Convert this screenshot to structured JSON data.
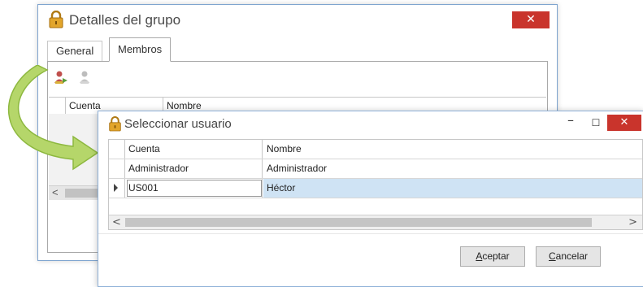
{
  "back_window": {
    "title": "Detalles del grupo",
    "close_glyph": "✕",
    "tabs": [
      {
        "label": "General"
      },
      {
        "label": "Membros"
      }
    ],
    "toolbar_icons": [
      "add-user-icon",
      "remove-user-icon"
    ],
    "grid_columns": [
      "Cuenta",
      "Nombre"
    ],
    "scroll_left_glyph": "<"
  },
  "front_window": {
    "title": "Seleccionar usuario",
    "minimize_glyph": "–",
    "maximize_glyph": "☐",
    "close_glyph": "✕",
    "columns": [
      "Cuenta",
      "Nombre"
    ],
    "rows": [
      {
        "cuenta": "Administrador",
        "nombre": "Administrador",
        "selected": false
      },
      {
        "cuenta": "US001",
        "nombre": "Héctor",
        "selected": true
      }
    ],
    "scroll_left_glyph": "<",
    "scroll_right_glyph": ">",
    "buttons": {
      "accept": {
        "accel": "A",
        "rest": "ceptar"
      },
      "cancel": {
        "accel": "C",
        "rest": "ancelar"
      }
    }
  },
  "colors": {
    "close_button": "#c9342c",
    "selection": "#cfe3f4",
    "arrow_green": "#a8cf5a",
    "lock_gold": "#e2a52b"
  }
}
